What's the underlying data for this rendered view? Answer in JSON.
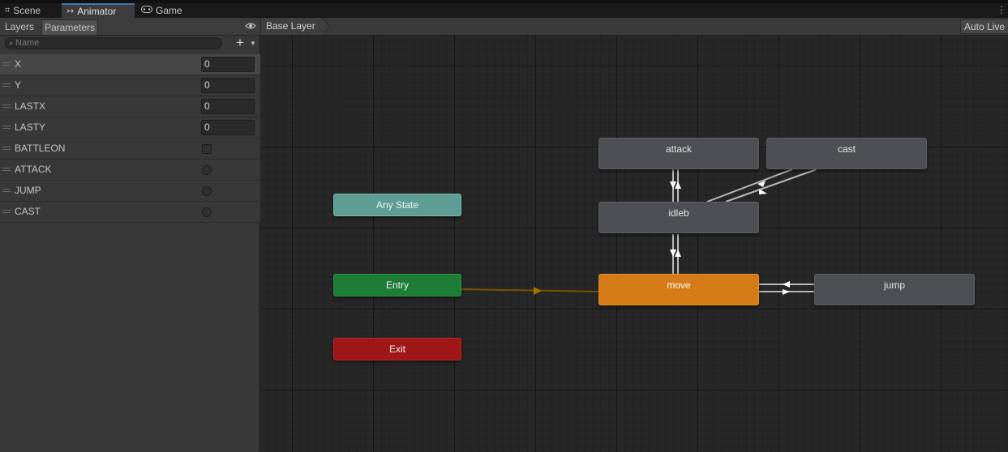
{
  "tabs": [
    {
      "label": "Scene",
      "icon": "grid-icon"
    },
    {
      "label": "Animator",
      "icon": "animator-icon",
      "active": true
    },
    {
      "label": "Game",
      "icon": "gamepad-icon"
    }
  ],
  "left_panel": {
    "tab_layers": "Layers",
    "tab_parameters": "Parameters",
    "search_placeholder": "Name",
    "add_label": "+",
    "parameters": [
      {
        "name": "X",
        "type": "float",
        "value": "0"
      },
      {
        "name": "Y",
        "type": "float",
        "value": "0"
      },
      {
        "name": "LASTX",
        "type": "float",
        "value": "0"
      },
      {
        "name": "LASTY",
        "type": "float",
        "value": "0"
      },
      {
        "name": "BATTLEON",
        "type": "bool",
        "value": false
      },
      {
        "name": "ATTACK",
        "type": "trigger",
        "value": false
      },
      {
        "name": "JUMP",
        "type": "trigger",
        "value": false
      },
      {
        "name": "CAST",
        "type": "trigger",
        "value": false
      }
    ]
  },
  "graph": {
    "breadcrumb": "Base Layer",
    "auto_live_link": "Auto Live",
    "states": {
      "any_state": "Any State",
      "entry": "Entry",
      "exit": "Exit",
      "attack": "attack",
      "cast": "cast",
      "idleb": "idleb",
      "move": "move",
      "jump": "jump"
    },
    "colors": {
      "default_state": "#4e4f52",
      "layer_default_state": "#d47a17",
      "any_state": "#5d9d94",
      "entry": "#1d7d36",
      "exit": "#a01717",
      "entry_transition": "#8a5a00"
    }
  }
}
